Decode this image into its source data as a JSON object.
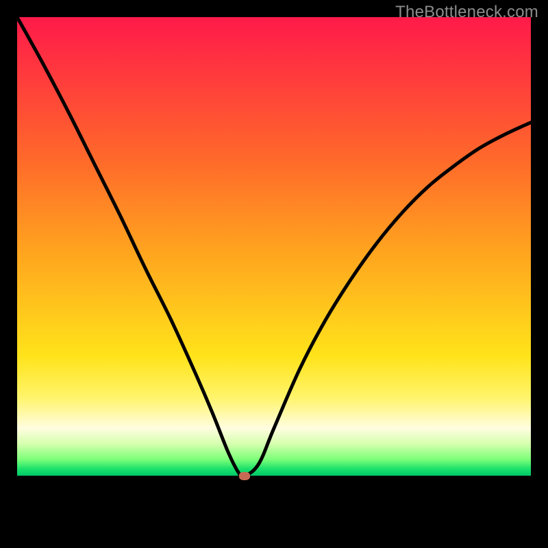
{
  "watermark": "TheBottleneck.com",
  "marker": {
    "x_frac": 0.442,
    "y_frac_from_top": 0.893
  },
  "chart_data": {
    "type": "line",
    "title": "",
    "xlabel": "",
    "ylabel": "",
    "xlim": [
      0,
      1
    ],
    "ylim": [
      0,
      1
    ],
    "series": [
      {
        "name": "bottleneck-curve",
        "x": [
          0.0,
          0.05,
          0.1,
          0.15,
          0.2,
          0.25,
          0.3,
          0.35,
          0.38,
          0.41,
          0.43,
          0.442,
          0.47,
          0.5,
          0.55,
          0.6,
          0.65,
          0.7,
          0.75,
          0.8,
          0.85,
          0.9,
          0.95,
          1.0
        ],
        "y": [
          1.0,
          0.91,
          0.815,
          0.715,
          0.615,
          0.51,
          0.41,
          0.3,
          0.23,
          0.155,
          0.115,
          0.107,
          0.13,
          0.2,
          0.315,
          0.41,
          0.49,
          0.56,
          0.62,
          0.67,
          0.71,
          0.745,
          0.772,
          0.795
        ]
      }
    ],
    "marker_point": {
      "x": 0.442,
      "y": 0.107
    },
    "gradient_stops": [
      {
        "pos": 0.0,
        "color": "#ff1a4a"
      },
      {
        "pos": 0.28,
        "color": "#ff6a2a"
      },
      {
        "pos": 0.66,
        "color": "#ffe31a"
      },
      {
        "pos": 0.86,
        "color": "#7fff7a"
      },
      {
        "pos": 0.893,
        "color": "#00c86a"
      },
      {
        "pos": 0.893,
        "color": "#000000"
      },
      {
        "pos": 1.0,
        "color": "#000000"
      }
    ]
  }
}
